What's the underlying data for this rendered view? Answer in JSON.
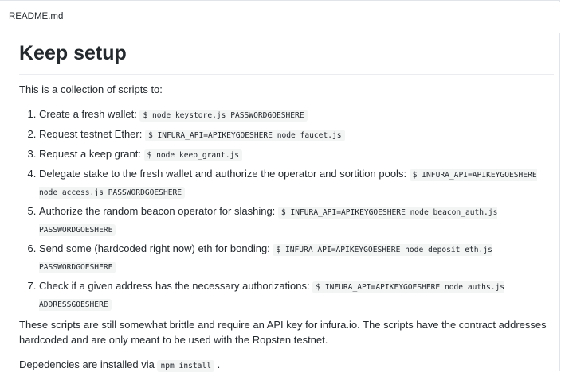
{
  "file": {
    "name": "README.md"
  },
  "readme": {
    "title": "Keep setup",
    "intro": "This is a collection of scripts to:",
    "steps": [
      {
        "text": "Create a fresh wallet: ",
        "code": "$ node keystore.js PASSWORDGOESHERE"
      },
      {
        "text": "Request testnet Ether: ",
        "code": "$ INFURA_API=APIKEYGOESHERE node faucet.js"
      },
      {
        "text": "Request a keep grant: ",
        "code": "$ node keep_grant.js"
      },
      {
        "text": "Delegate stake to the fresh wallet and authorize the operator and sortition pools: ",
        "code": "$ INFURA_API=APIKEYGOESHERE node access.js PASSWORDGOESHERE"
      },
      {
        "text": "Authorize the random beacon operator for slashing: ",
        "code": "$ INFURA_API=APIKEYGOESHERE node beacon_auth.js PASSWORDGOESHERE"
      },
      {
        "text": "Send some (hardcoded right now) eth for bonding: ",
        "code": "$ INFURA_API=APIKEYGOESHERE node deposit_eth.js PASSWORDGOESHERE"
      },
      {
        "text": "Check if a given address has the necessary authorizations: ",
        "code": "$ INFURA_API=APIKEYGOESHERE node auths.js ADDRESSGOESHERE"
      }
    ],
    "outro": "These scripts are still somewhat brittle and require an API key for infura.io. The scripts have the contract addresses hardcoded and are only meant to be used with the Ropsten testnet.",
    "deps_prefix": "Depedencies are installed via ",
    "deps_code": "npm install",
    "deps_suffix": " ."
  }
}
